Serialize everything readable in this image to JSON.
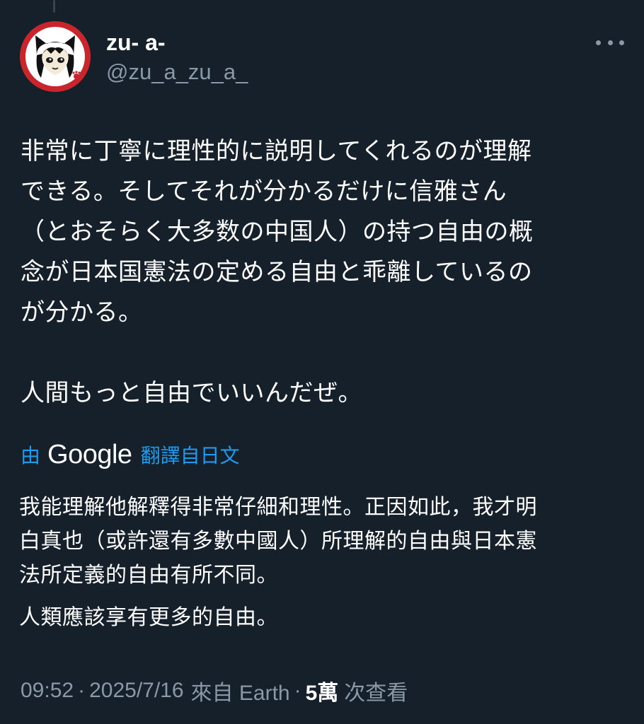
{
  "tweet": {
    "author": {
      "display_name": "zu- a-",
      "handle": "@zu_a_zu_a_"
    },
    "text_lines_p1": [
      "非常に丁寧に理性的に説明してくれるのが理解",
      "できる。そしてそれが分かるだけに信雅さん",
      "（とおそらく大多数の中国人）の持つ自由の概",
      "念が日本国憲法の定める自由と乖離しているの",
      "が分かる。"
    ],
    "text_p2": "人間もっと自由でいいんだぜ。",
    "translation": {
      "prefix": "由",
      "provider": "Google",
      "suffix": "翻譯自日文",
      "lines_p1": [
        "我能理解他解釋得非常仔細和理性。正因如此，我才明",
        "白真也（或許還有多數中國人）所理解的自由與日本憲",
        "法所定義的自由有所不同。"
      ],
      "text_p2": "人類應該享有更多的自由。"
    },
    "meta": {
      "time": "09:52",
      "separator": "·",
      "date": "2025/7/16",
      "source": "來自 Earth",
      "views_count": "5萬",
      "views_label": "次查看"
    }
  },
  "icons": {
    "avatar": "cat-ear-girl-avatar",
    "more": "more-horizontal-icon"
  },
  "colors": {
    "background": "#15202b",
    "text_primary": "#ffffff",
    "text_secondary": "#8b98a5",
    "accent": "#1d9bf0",
    "avatar_ring": "#c8252c"
  }
}
